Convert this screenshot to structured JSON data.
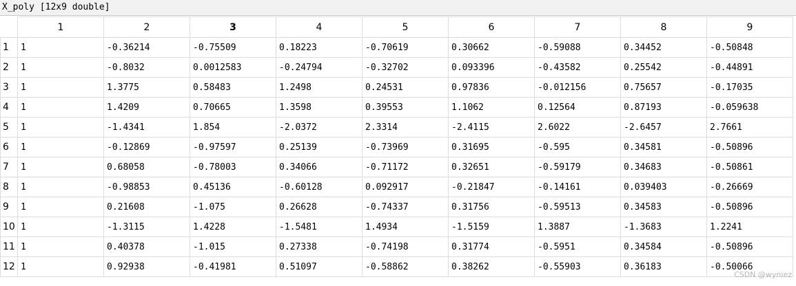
{
  "window": {
    "title": "X_poly [12x9 double]"
  },
  "table": {
    "selected_column": "3",
    "column_headers": [
      "1",
      "2",
      "3",
      "4",
      "5",
      "6",
      "7",
      "8",
      "9"
    ],
    "rows": [
      {
        "label": "1",
        "cells": [
          "1",
          "-0.36214",
          "-0.75509",
          "0.18223",
          "-0.70619",
          "0.30662",
          "-0.59088",
          "0.34452",
          "-0.50848"
        ]
      },
      {
        "label": "2",
        "cells": [
          "1",
          "-0.8032",
          "0.0012583",
          "-0.24794",
          "-0.32702",
          "0.093396",
          "-0.43582",
          "0.25542",
          "-0.44891"
        ]
      },
      {
        "label": "3",
        "cells": [
          "1",
          "1.3775",
          "0.58483",
          "1.2498",
          "0.24531",
          "0.97836",
          "-0.012156",
          "0.75657",
          "-0.17035"
        ]
      },
      {
        "label": "4",
        "cells": [
          "1",
          "1.4209",
          "0.70665",
          "1.3598",
          "0.39553",
          "1.1062",
          "0.12564",
          "0.87193",
          "-0.059638"
        ]
      },
      {
        "label": "5",
        "cells": [
          "1",
          "-1.4341",
          "1.854",
          "-2.0372",
          "2.3314",
          "-2.4115",
          "2.6022",
          "-2.6457",
          "2.7661"
        ]
      },
      {
        "label": "6",
        "cells": [
          "1",
          "-0.12869",
          "-0.97597",
          "0.25139",
          "-0.73969",
          "0.31695",
          "-0.595",
          "0.34581",
          "-0.50896"
        ]
      },
      {
        "label": "7",
        "cells": [
          "1",
          "0.68058",
          "-0.78003",
          "0.34066",
          "-0.71172",
          "0.32651",
          "-0.59179",
          "0.34683",
          "-0.50861"
        ]
      },
      {
        "label": "8",
        "cells": [
          "1",
          "-0.98853",
          "0.45136",
          "-0.60128",
          "0.092917",
          "-0.21847",
          "-0.14161",
          "0.039403",
          "-0.26669"
        ]
      },
      {
        "label": "9",
        "cells": [
          "1",
          "0.21608",
          "-1.075",
          "0.26628",
          "-0.74337",
          "0.31756",
          "-0.59513",
          "0.34583",
          "-0.50896"
        ]
      },
      {
        "label": "10",
        "cells": [
          "1",
          "-1.3115",
          "1.4228",
          "-1.5481",
          "1.4934",
          "-1.5159",
          "1.3887",
          "-1.3683",
          "1.2241"
        ]
      },
      {
        "label": "11",
        "cells": [
          "1",
          "0.40378",
          "-1.015",
          "0.27338",
          "-0.74198",
          "0.31774",
          "-0.5951",
          "0.34584",
          "-0.50896"
        ]
      },
      {
        "label": "12",
        "cells": [
          "1",
          "0.92938",
          "-0.41981",
          "0.51097",
          "-0.58862",
          "0.38262",
          "-0.55903",
          "0.36183",
          "-0.50066"
        ]
      }
    ]
  },
  "watermark": "CSDN @wyniez"
}
